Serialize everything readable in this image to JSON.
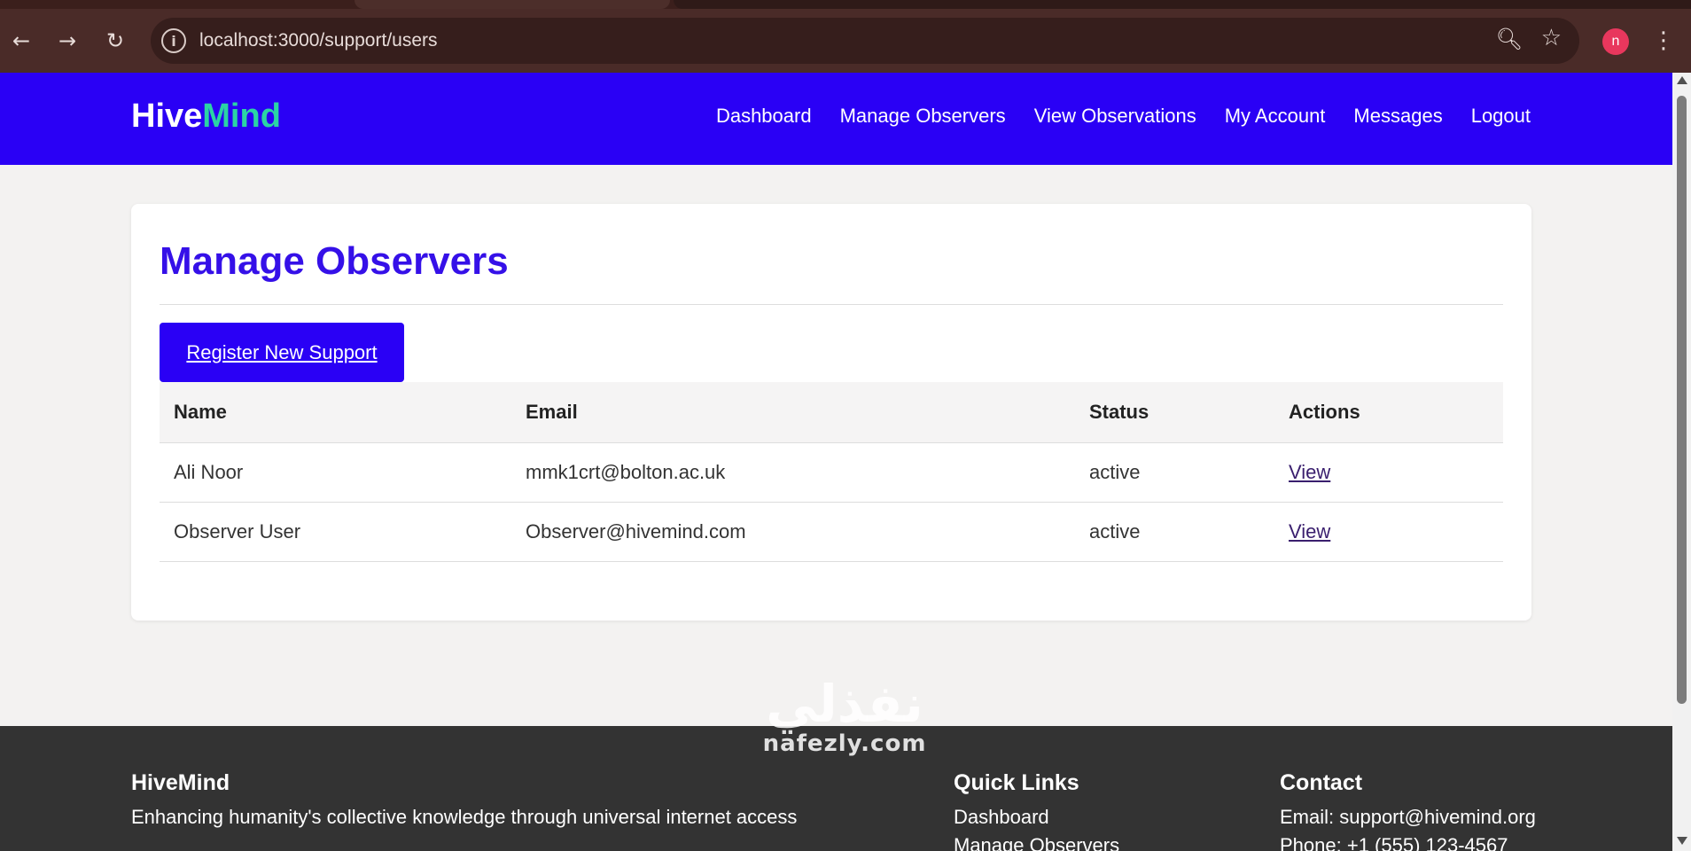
{
  "browser": {
    "url": "localhost:3000/support/users",
    "profile_initial": "n",
    "icons": {
      "back": "arrow-left-icon",
      "forward": "arrow-right-icon",
      "reload": "reload-icon",
      "site_info": "info-icon",
      "zoom": "zoom-icon",
      "bookmark": "star-icon",
      "menu": "kebab-menu-icon"
    }
  },
  "header": {
    "logo_part1": "Hive",
    "logo_part2": "Mind",
    "nav": [
      "Dashboard",
      "Manage Observers",
      "View Observations",
      "My Account",
      "Messages",
      "Logout"
    ]
  },
  "main": {
    "title": "Manage Observers",
    "register_button": "Register New Support",
    "table": {
      "headers": [
        "Name",
        "Email",
        "Status",
        "Actions"
      ],
      "rows": [
        {
          "name": "Ali Noor",
          "email": "mmk1crt@bolton.ac.uk",
          "status": "active",
          "action": "View"
        },
        {
          "name": "Observer User",
          "email": "Observer@hivemind.com",
          "status": "active",
          "action": "View"
        }
      ]
    }
  },
  "footer": {
    "about_heading": "HiveMind",
    "about_text": "Enhancing humanity's collective knowledge through universal internet access",
    "links_heading": "Quick Links",
    "links": [
      "Dashboard",
      "Manage Observers"
    ],
    "contact_heading": "Contact",
    "contact_email": "Email: support@hivemind.org",
    "contact_phone": "Phone: +1 (555) 123-4567"
  },
  "watermark": {
    "arabic": "نفذلي",
    "latin": "nafezly.com"
  },
  "colors": {
    "brand_blue": "#2a00f5",
    "title_blue": "#3510e8",
    "logo_accent": "#2bd4a4",
    "status_active": "#19b46a",
    "footer_bg": "#333333"
  }
}
